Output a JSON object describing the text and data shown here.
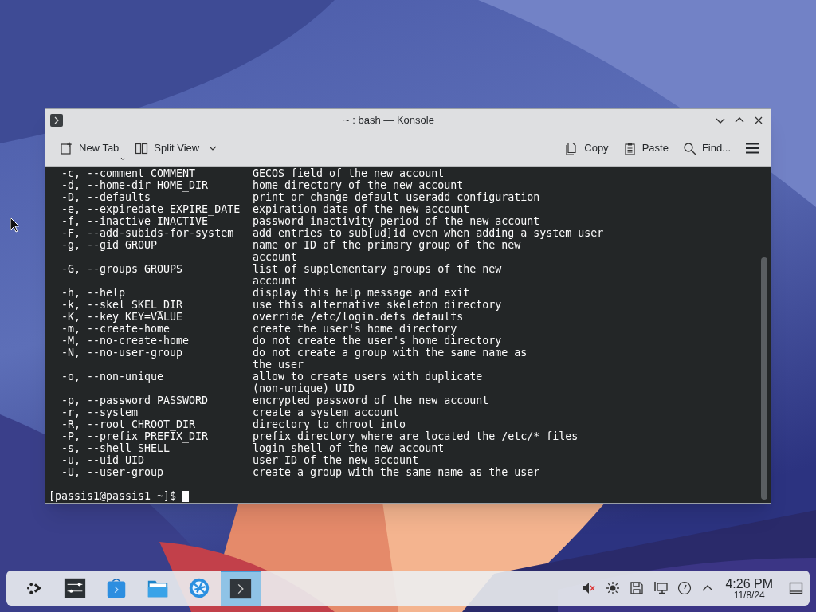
{
  "window": {
    "title": "~ : bash — Konsole"
  },
  "toolbar": {
    "left": [
      {
        "kind": "new-tab",
        "label": "New Tab"
      },
      {
        "kind": "split-view",
        "label": "Split View"
      }
    ],
    "right": [
      {
        "kind": "copy",
        "label": "Copy"
      },
      {
        "kind": "paste",
        "label": "Paste"
      },
      {
        "kind": "find",
        "label": "Find..."
      }
    ]
  },
  "terminal": {
    "rows": [
      {
        "option": "-c, --comment COMMENT",
        "description": "GECOS field of the new account"
      },
      {
        "option": "-d, --home-dir HOME_DIR",
        "description": "home directory of the new account"
      },
      {
        "option": "-D, --defaults",
        "description": "print or change default useradd configuration"
      },
      {
        "option": "-e, --expiredate EXPIRE_DATE",
        "description": "expiration date of the new account"
      },
      {
        "option": "-f, --inactive INACTIVE",
        "description": "password inactivity period of the new account"
      },
      {
        "option": "-F, --add-subids-for-system",
        "description": "add entries to sub[ud]id even when adding a system user"
      },
      {
        "option": "-g, --gid GROUP",
        "description": "name or ID of the primary group of the new"
      },
      {
        "description": "account"
      },
      {
        "option": "-G, --groups GROUPS",
        "description": "list of supplementary groups of the new"
      },
      {
        "description": "account"
      },
      {
        "option": "-h, --help",
        "description": "display this help message and exit"
      },
      {
        "option": "-k, --skel SKEL_DIR",
        "description": "use this alternative skeleton directory"
      },
      {
        "option": "-K, --key KEY=VALUE",
        "description": "override /etc/login.defs defaults"
      },
      {
        "option": "-m, --create-home",
        "description": "create the user's home directory"
      },
      {
        "option": "-M, --no-create-home",
        "description": "do not create the user's home directory"
      },
      {
        "option": "-N, --no-user-group",
        "description": "do not create a group with the same name as"
      },
      {
        "description": "the user"
      },
      {
        "option": "-o, --non-unique",
        "description": "allow to create users with duplicate"
      },
      {
        "description": "(non-unique) UID"
      },
      {
        "option": "-p, --password PASSWORD",
        "description": "encrypted password of the new account"
      },
      {
        "option": "-r, --system",
        "description": "create a system account"
      },
      {
        "option": "-R, --root CHROOT_DIR",
        "description": "directory to chroot into"
      },
      {
        "option": "-P, --prefix PREFIX_DIR",
        "description": "prefix directory where are located the /etc/* files"
      },
      {
        "option": "-s, --shell SHELL",
        "description": "login shell of the new account"
      },
      {
        "option": "-u, --uid UID",
        "description": "user ID of the new account"
      },
      {
        "option": "-U, --user-group",
        "description": "create a group with the same name as the user"
      }
    ],
    "prompt": "[passis1@passis1 ~]$"
  },
  "taskbar": {
    "apps": [
      {
        "kind": "launcher",
        "selected": false
      },
      {
        "kind": "settings",
        "selected": false
      },
      {
        "kind": "discover",
        "selected": false
      },
      {
        "kind": "files",
        "selected": false
      },
      {
        "kind": "browser",
        "selected": false
      },
      {
        "kind": "terminal",
        "selected": true
      }
    ],
    "clock": {
      "time": "4:26 PM",
      "date": "11/8/24"
    }
  }
}
